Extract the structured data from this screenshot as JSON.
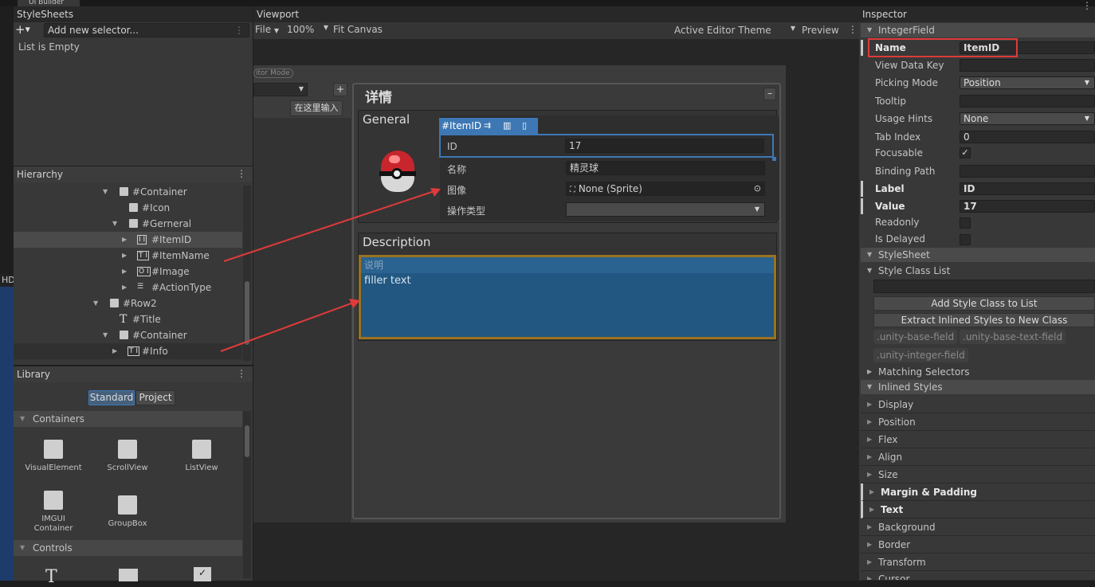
{
  "window": {
    "tab_title": "UI Builder"
  },
  "stylesheets": {
    "title": "StyleSheets",
    "add_selector_placeholder": "Add new selector...",
    "empty_text": "List is Empty"
  },
  "hierarchy": {
    "title": "Hierarchy",
    "items": [
      {
        "label": "#Container"
      },
      {
        "label": "#Icon"
      },
      {
        "label": "#Gerneral"
      },
      {
        "label": "#ItemID"
      },
      {
        "label": "#ItemName"
      },
      {
        "label": "#Image"
      },
      {
        "label": "#ActionType"
      },
      {
        "label": "#Row2"
      },
      {
        "label": "#Title"
      },
      {
        "label": "#Container"
      },
      {
        "label": "#Info"
      }
    ]
  },
  "library": {
    "title": "Library",
    "tabs": [
      "Standard",
      "Project"
    ],
    "containers_label": "Containers",
    "controls_label": "Controls",
    "items": [
      "VisualElement",
      "ScrollView",
      "ListView",
      "IMGUI Container",
      "GroupBox"
    ]
  },
  "viewport": {
    "title": "Viewport",
    "file_menu": "File",
    "zoom": "100%",
    "fit_canvas": "Fit Canvas",
    "theme": "Active Editor Theme",
    "preview": "Preview",
    "editor_mode": "itor Mode",
    "input_hint": "在这里输入",
    "panel_title": "详情",
    "general_label": "General",
    "selected_tag": "#ItemID",
    "fields": [
      {
        "label": "ID",
        "value": "17"
      },
      {
        "label": "名称",
        "value": "精灵球"
      },
      {
        "label": "图像",
        "value": "None (Sprite)"
      },
      {
        "label": "操作类型",
        "value": ""
      }
    ],
    "description_label": "Description",
    "description_placeholder": "说明",
    "description_text": "filler text"
  },
  "inspector": {
    "title": "Inspector",
    "component": "IntegerField",
    "rows": [
      {
        "label": "Name",
        "value": "ItemID"
      },
      {
        "label": "View Data Key",
        "value": ""
      },
      {
        "label": "Picking Mode",
        "value": "Position"
      },
      {
        "label": "Tooltip",
        "value": ""
      },
      {
        "label": "Usage Hints",
        "value": "None"
      },
      {
        "label": "Tab Index",
        "value": "0"
      },
      {
        "label": "Focusable",
        "value": "✓"
      },
      {
        "label": "Binding Path",
        "value": ""
      },
      {
        "label": "Label",
        "value": "ID"
      },
      {
        "label": "Value",
        "value": "17"
      },
      {
        "label": "Readonly",
        "value": ""
      },
      {
        "label": "Is Delayed",
        "value": ""
      }
    ],
    "stylesheet_label": "StyleSheet",
    "style_class_list": "Style Class List",
    "add_style_class": "Add Style Class to List",
    "extract_styles": "Extract Inlined Styles to New Class",
    "classes": [
      ".unity-base-field",
      ".unity-base-text-field",
      ".unity-integer-field"
    ],
    "matching_selectors": "Matching Selectors",
    "inlined_styles": "Inlined Styles",
    "style_sections": [
      "Display",
      "Position",
      "Flex",
      "Align",
      "Size",
      "Margin & Padding",
      "Text",
      "Background",
      "Border",
      "Transform",
      "Cursor"
    ]
  },
  "colors": {
    "accent": "#3d78b5",
    "highlight_red": "#e03a3a",
    "selection_orange": "#b8862b"
  }
}
